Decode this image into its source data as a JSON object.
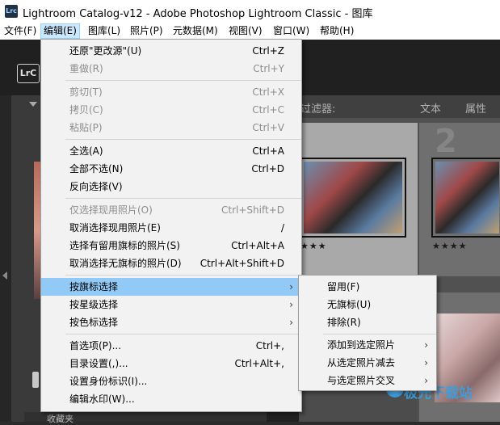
{
  "window": {
    "title": "Lightroom Catalog-v12 - Adobe Photoshop Lightroom Classic - 图库",
    "icon_label": "Lrc"
  },
  "menubar": [
    {
      "label": "文件(F)"
    },
    {
      "label": "编辑(E)"
    },
    {
      "label": "图库(L)"
    },
    {
      "label": "照片(P)"
    },
    {
      "label": "元数据(M)"
    },
    {
      "label": "视图(V)"
    },
    {
      "label": "窗口(W)"
    },
    {
      "label": "帮助(H)"
    }
  ],
  "lr": {
    "badge": "LrC",
    "filter_label": "过滤器:",
    "filter_options": [
      "文本",
      "属性"
    ],
    "cell_numbers": [
      "2"
    ],
    "stars": [
      "★★★",
      "★★★★"
    ],
    "bottom_tab": "收藏夹"
  },
  "edit_menu": {
    "items": [
      {
        "label": "还原\"更改源\"(U)",
        "shortcut": "Ctrl+Z",
        "disabled": false
      },
      {
        "label": "重做(R)",
        "shortcut": "Ctrl+Y",
        "disabled": true
      },
      {
        "label": "剪切(T)",
        "shortcut": "Ctrl+X",
        "disabled": true
      },
      {
        "label": "拷贝(C)",
        "shortcut": "Ctrl+C",
        "disabled": true
      },
      {
        "label": "粘贴(P)",
        "shortcut": "Ctrl+V",
        "disabled": true
      },
      {
        "label": "全选(A)",
        "shortcut": "Ctrl+A",
        "disabled": false
      },
      {
        "label": "全部不选(N)",
        "shortcut": "Ctrl+D",
        "disabled": false
      },
      {
        "label": "反向选择(V)",
        "shortcut": "",
        "disabled": false
      },
      {
        "label": "仅选择现用照片(O)",
        "shortcut": "Ctrl+Shift+D",
        "disabled": true
      },
      {
        "label": "取消选择现用照片(E)",
        "shortcut": "/",
        "disabled": false
      },
      {
        "label": "选择有留用旗标的照片(S)",
        "shortcut": "Ctrl+Alt+A",
        "disabled": false
      },
      {
        "label": "取消选择无旗标的照片(D)",
        "shortcut": "Ctrl+Alt+Shift+D",
        "disabled": false
      },
      {
        "label": "按旗标选择",
        "shortcut": "",
        "disabled": false,
        "submenu": true
      },
      {
        "label": "按星级选择",
        "shortcut": "",
        "disabled": false,
        "submenu": true
      },
      {
        "label": "按色标选择",
        "shortcut": "",
        "disabled": false,
        "submenu": true
      },
      {
        "label": "首选项(P)...",
        "shortcut": "Ctrl+,",
        "disabled": false
      },
      {
        "label": "目录设置(,)...",
        "shortcut": "Ctrl+Alt+,",
        "disabled": false
      },
      {
        "label": "设置身份标识(I)...",
        "shortcut": "",
        "disabled": false
      },
      {
        "label": "编辑水印(W)...",
        "shortcut": "",
        "disabled": false
      }
    ]
  },
  "flag_submenu": {
    "items": [
      {
        "label": "留用(F)"
      },
      {
        "label": "无旗标(U)"
      },
      {
        "label": "排除(R)"
      },
      {
        "label": "添加到选定照片"
      },
      {
        "label": "从选定照片减去"
      },
      {
        "label": "与选定照片交叉"
      }
    ]
  },
  "watermark": {
    "text": "极光下载站"
  },
  "colors": {
    "highlight": "#91c9f7",
    "menu_bg": "#f2f2f2",
    "active_menubar": "#cce8ff"
  }
}
